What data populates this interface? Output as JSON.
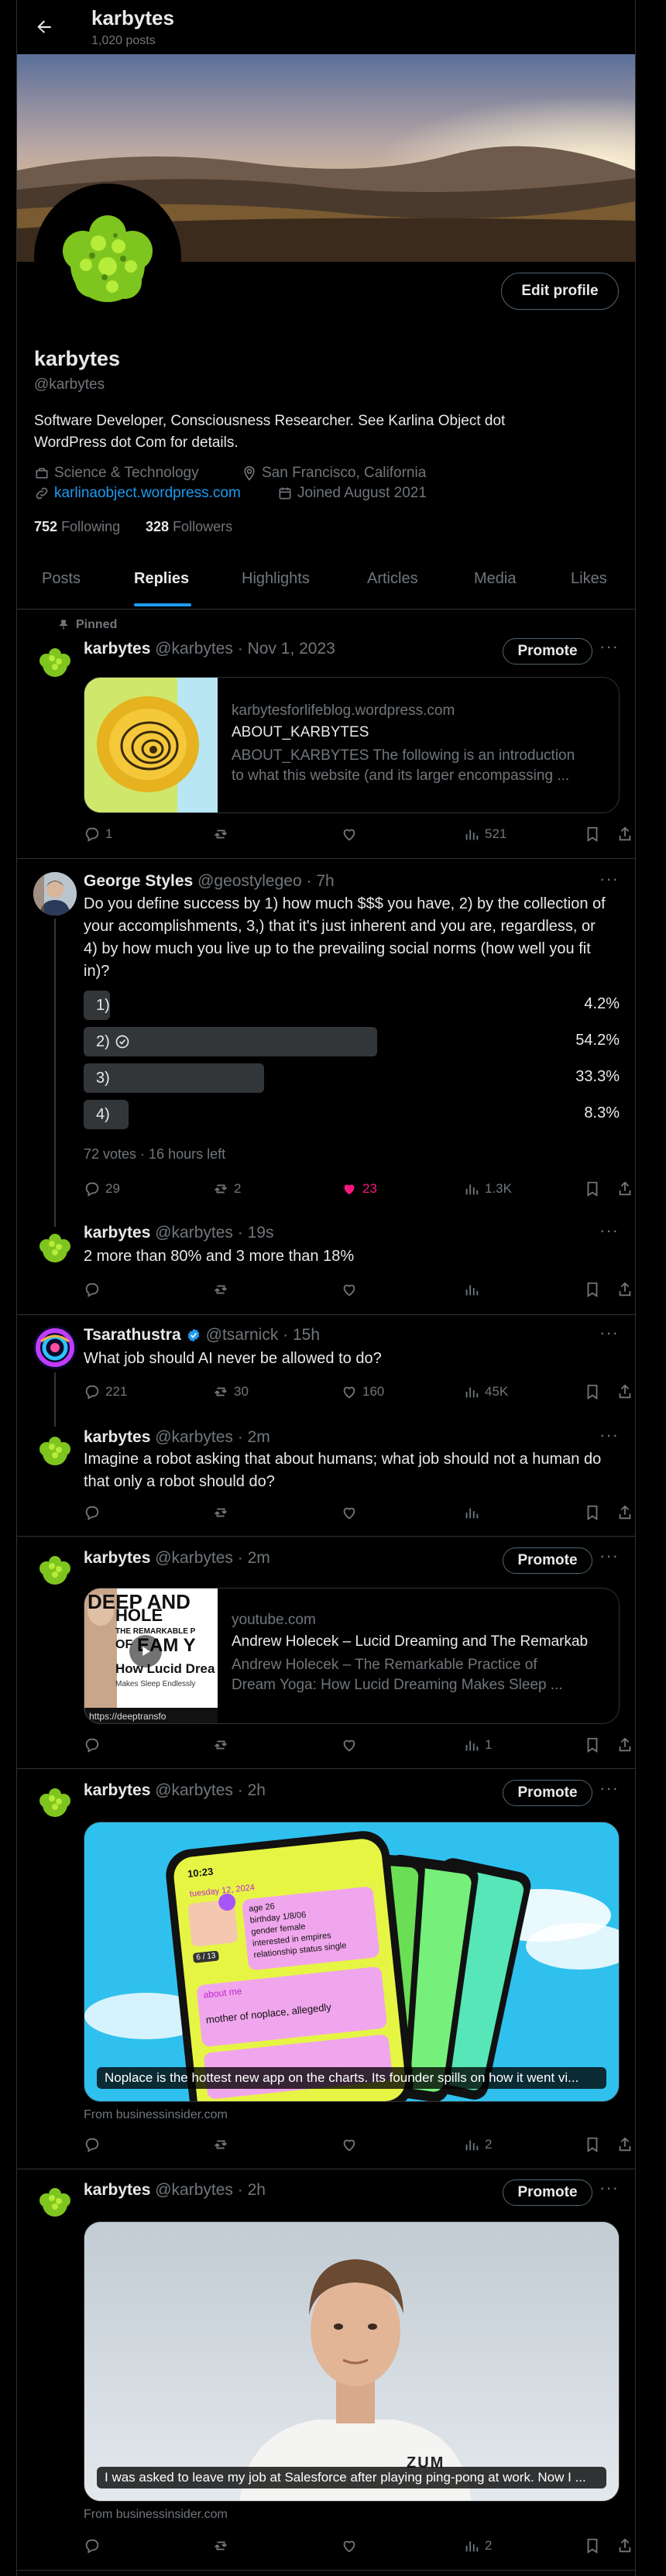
{
  "header": {
    "title": "karbytes",
    "posts_count": "1,020 posts",
    "edit_profile": "Edit profile"
  },
  "profile": {
    "name": "karbytes",
    "handle": "@karbytes",
    "bio": [
      "Software Developer, Consciousness Researcher. See Karlina Object dot",
      "WordPress dot Com for details."
    ],
    "category": "Science & Technology",
    "location": "San Francisco, California",
    "website": "karlinaobject.wordpress.com",
    "joined": "Joined August 2021",
    "following_count": "752",
    "following_label": "Following",
    "followers_count": "328",
    "followers_label": "Followers"
  },
  "tabs": [
    "Posts",
    "Replies",
    "Highlights",
    "Articles",
    "Media",
    "Likes"
  ],
  "common": {
    "promote": "Promote",
    "more": "···"
  },
  "posts": [
    {
      "pinned": "Pinned",
      "name": "karbytes",
      "meta": "@karbytes · Nov 1, 2023",
      "card": {
        "domain": "karbytesforlifeblog.wordpress.com",
        "title": "ABOUT_KARBYTES",
        "desc": [
          "ABOUT_KARBYTES The following is an introduction",
          "to what this website (and its larger encompassing ..."
        ]
      },
      "stats": {
        "replies": "1",
        "reposts": "",
        "likes": "",
        "views": "521"
      }
    },
    {
      "name": "George Styles",
      "meta": "@geostylegeo · 7h",
      "text": [
        "Do you define success by 1) how much $$$ you have, 2) by the collection of",
        "your accomplishments, 3,) that it's just inherent and you are, regardless, or",
        "4) by how much you live up to the prevailing social norms (how well you fit",
        "in)?"
      ],
      "poll": [
        {
          "label": "1)",
          "pct": "4.2%",
          "value": 4.2
        },
        {
          "label": "2)",
          "pct": "54.2%",
          "value": 54.2
        },
        {
          "label": "3)",
          "pct": "33.3%",
          "value": 33.3
        },
        {
          "label": "4)",
          "pct": "8.3%",
          "value": 8.3
        }
      ],
      "poll_meta": "72 votes · 16 hours left",
      "stats": {
        "replies": "29",
        "reposts": "2",
        "likes": "23",
        "views": "1.3K"
      }
    },
    {
      "name": "karbytes",
      "meta": "@karbytes · 19s",
      "text": [
        "2 more than 80% and 3 more than 18%"
      ],
      "stats": {
        "replies": "",
        "reposts": "",
        "likes": "",
        "views": ""
      }
    },
    {
      "name": "Tsarathustra",
      "meta": "@tsarnick · 15h",
      "text": [
        "What job should AI never be allowed to do?"
      ],
      "stats": {
        "replies": "221",
        "reposts": "30",
        "likes": "160",
        "views": "45K"
      }
    },
    {
      "name": "karbytes",
      "meta": "@karbytes · 2m",
      "text": [
        "Imagine a robot asking that about humans; what job should not a human do",
        "that only a robot should do?"
      ],
      "stats": {
        "replies": "",
        "reposts": "",
        "likes": "",
        "views": ""
      }
    },
    {
      "name": "karbytes",
      "meta": "@karbytes · 2m",
      "card": {
        "domain": "youtube.com",
        "title": "Andrew Holecek – Lucid Dreaming and The Remarkab",
        "desc": [
          "Andrew Holecek – The Remarkable Practice of",
          "Dream Yoga: How Lucid Dreaming Makes Sleep ..."
        ],
        "thumb_url": "https://deeptransfo",
        "thumb_title": [
          "DEEP AND",
          "HOLE",
          "THE REMARKABLE P",
          "OF",
          "EAM Y",
          "How Lucid Drea",
          "Makes Sleep Endlessly"
        ]
      },
      "stats": {
        "replies": "",
        "reposts": "",
        "likes": "",
        "views": "1"
      }
    },
    {
      "name": "karbytes",
      "meta": "@karbytes · 2h",
      "caption": "Noplace is the hottest new app on the charts. Its founder spills on how it went vi...",
      "source": "From businessinsider.com",
      "phone": {
        "time": "10:23",
        "date": "tuesday 12, 2024",
        "age": "age 26",
        "birthday": "birthday 1/8/06",
        "gender": "gender female",
        "interested": "interested in empires",
        "relationship": "relationship status single",
        "about": "about me",
        "about_text": "mother of noplace, allegedly",
        "counter": "6 / 13"
      },
      "stats": {
        "replies": "",
        "reposts": "",
        "likes": "",
        "views": "2"
      }
    },
    {
      "name": "karbytes",
      "meta": "@karbytes · 2h",
      "caption": "I was asked to leave my job at Salesforce after playing ping-pong at work. Now I ...",
      "source": "From businessinsider.com",
      "shirt": "ZUM",
      "stats": {
        "replies": "",
        "reposts": "",
        "likes": "",
        "views": "2"
      }
    }
  ],
  "colors": {
    "accent": "#1d9bf0",
    "like_active": "#f91880",
    "border": "#2f3336",
    "muted": "#71767b",
    "verified": "#1d9bf0"
  }
}
